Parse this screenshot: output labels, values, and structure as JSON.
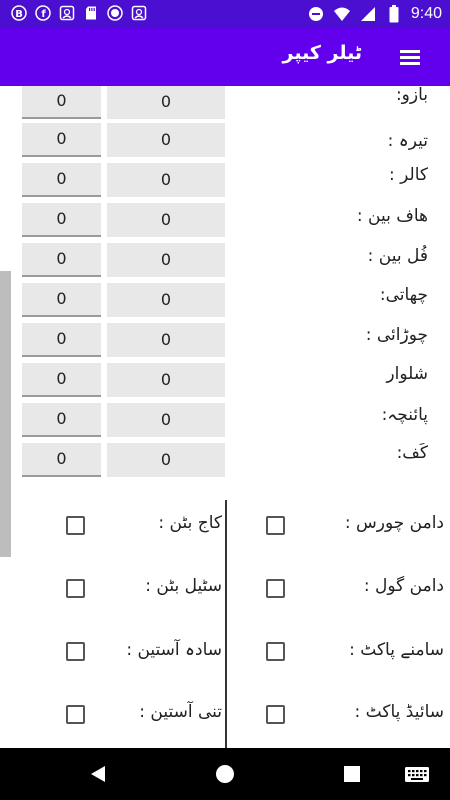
{
  "status_bar": {
    "time": "9:40",
    "left_icons": [
      "b-circle-icon",
      "facebook-icon",
      "photo-icon",
      "sd-card-icon",
      "record-icon",
      "photo-icon-2"
    ],
    "right_icons": [
      "dnd-icon",
      "wifi-icon",
      "signal-icon",
      "battery-icon"
    ]
  },
  "app_bar": {
    "title": "ٹیلر کیپر",
    "menu_icon": "hamburger-menu-icon"
  },
  "measurements": [
    {
      "label": "بازو:",
      "value_a": "0",
      "value_b": "0"
    },
    {
      "label": "تیرہ :",
      "value_a": "0",
      "value_b": "0"
    },
    {
      "label": "کالر :",
      "value_a": "0",
      "value_b": "0"
    },
    {
      "label": "ھاف بین :",
      "value_a": "0",
      "value_b": "0"
    },
    {
      "label": "فُل بین :",
      "value_a": "0",
      "value_b": "0"
    },
    {
      "label": "چھاتی:",
      "value_a": "0",
      "value_b": "0"
    },
    {
      "label": "چوڑائی :",
      "value_a": "0",
      "value_b": "0"
    },
    {
      "label": "شلوار",
      "value_a": "0",
      "value_b": "0"
    },
    {
      "label": "پائنچہ:",
      "value_a": "0",
      "value_b": "0"
    },
    {
      "label": "کَف:",
      "value_a": "0",
      "value_b": "0"
    }
  ],
  "options": {
    "right_column": [
      {
        "label": "دامن چورس :",
        "checked": false
      },
      {
        "label": "دامن گول :",
        "checked": false
      },
      {
        "label": "سامنے پاکٹ :",
        "checked": false
      },
      {
        "label": "سائیڈ پاکٹ :",
        "checked": false
      }
    ],
    "left_column": [
      {
        "label": "کاج بٹن :",
        "checked": false
      },
      {
        "label": "سٹیل بٹن :",
        "checked": false
      },
      {
        "label": "سادہ آستین :",
        "checked": false
      },
      {
        "label": "تنی آستین :",
        "checked": false
      }
    ]
  },
  "nav_bar": {
    "icons": [
      "back-icon",
      "home-icon",
      "recents-icon",
      "keyboard-icon"
    ]
  },
  "colors": {
    "status_bar": "#4a0fd0",
    "app_bar": "#6200ee",
    "field_bg": "#e8e8e8"
  }
}
